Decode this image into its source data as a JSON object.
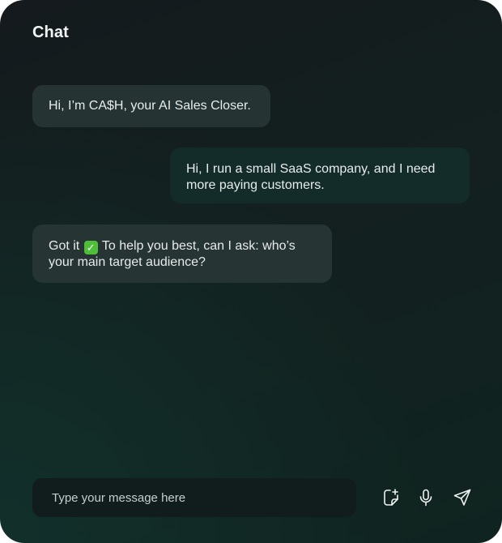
{
  "header": {
    "title": "Chat"
  },
  "messages": [
    {
      "role": "bot",
      "text": "Hi, I’m CA$H, your AI Sales Closer."
    },
    {
      "role": "user",
      "text": "Hi, I run a small SaaS company, and I need more paying customers."
    },
    {
      "role": "bot",
      "text_before": "Got it",
      "emoji": "✓",
      "emoji_name": "check-mark-button-emoji",
      "text_after": "To help you best, can I ask: who’s your main target audience?"
    }
  ],
  "composer": {
    "placeholder": "Type your message here",
    "value": "",
    "actions": [
      {
        "name": "attach-icon"
      },
      {
        "name": "microphone-icon"
      },
      {
        "name": "send-icon"
      }
    ]
  },
  "colors": {
    "panel_background": "#131d1f",
    "bot_bubble": "#253332",
    "user_bubble": "#132c2a",
    "input_background": "#101d1c",
    "text": "#e7eceb",
    "check_green": "#4fbf3a"
  }
}
